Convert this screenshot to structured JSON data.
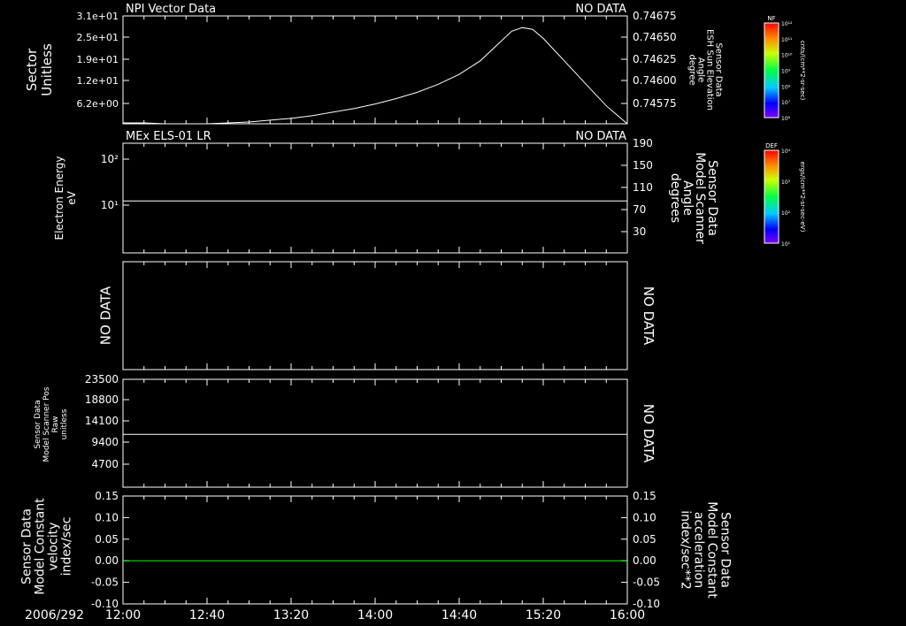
{
  "colors": {
    "background": "#000000",
    "foreground": "#ffffff",
    "model_line": "#00ff00",
    "right_label_panel5": "#00ff00"
  },
  "time_axis": {
    "date_label": "2006/292",
    "start": "12:00",
    "end": "16:00",
    "tick_labels": [
      "12:00",
      "12:40",
      "13:20",
      "14:00",
      "14:40",
      "15:20",
      "16:00"
    ]
  },
  "panels": [
    {
      "id": "panel1",
      "title_left": "NPI Vector Data",
      "title_right": "NO DATA",
      "left_label_lines": [
        "Sector",
        "Unitless"
      ],
      "left_ticks": [
        "3.1e+01",
        "2.5e+01",
        "1.9e+01",
        "1.2e+01",
        "6.2e+00"
      ],
      "right_label_lines": [
        "Sensor Data",
        "ESH Sun Elevation",
        "Angle",
        "degree"
      ],
      "right_ticks": [
        "0.74675",
        "0.74650",
        "0.74625",
        "0.74600",
        "0.74575"
      ]
    },
    {
      "id": "panel2",
      "title_left": "MEx ELS-01 LR",
      "title_right": "NO DATA",
      "left_label_lines": [
        "Electron Energy",
        "eV"
      ],
      "left_ticks": [
        "10²",
        "10¹"
      ],
      "right_label_lines": [
        "Sensor Data",
        "Model Scanner",
        "Angle",
        "degrees"
      ],
      "right_ticks": [
        "190",
        "150",
        "110",
        "70",
        "30"
      ]
    },
    {
      "id": "panel3",
      "left_label_lines": [
        "NO DATA"
      ],
      "right_label_lines": [
        "NO DATA"
      ]
    },
    {
      "id": "panel4",
      "left_label_lines": [
        "Sensor Data",
        "Model Scanner Pos",
        "Raw",
        "unitless"
      ],
      "left_ticks": [
        "23500",
        "18800",
        "14100",
        "9400",
        "4700"
      ],
      "right_label_lines": [
        "NO DATA"
      ]
    },
    {
      "id": "panel5",
      "left_label_lines": [
        "Sensor Data",
        "Model Constant",
        "velocity",
        "index/sec"
      ],
      "left_ticks": [
        "0.15",
        "0.10",
        "0.05",
        "0.00",
        "-0.05",
        "-0.10"
      ],
      "right_label_lines": [
        "Sensor Data",
        "Model Constant",
        "acceleration",
        "index/sec**2"
      ],
      "right_ticks": [
        "0.15",
        "0.10",
        "0.05",
        "0.00",
        "-0.05",
        "-0.10"
      ]
    }
  ],
  "colorbars": [
    {
      "id": "colorbar-nf",
      "title": "NF",
      "tick_labels": [
        "10¹²",
        "10¹¹",
        "10¹⁰",
        "10⁹",
        "10⁸",
        "10⁷",
        "10⁶"
      ],
      "unit": "cnts/(cm**2-sr-sec)"
    },
    {
      "id": "colorbar-def",
      "title": "DEF",
      "tick_labels": [
        "10⁴",
        "10³",
        "10²",
        "10¹"
      ],
      "unit": "ergs/(cm**2-sr-sec-eV)"
    }
  ],
  "chart_data": [
    {
      "type": "line",
      "panel": "panel1",
      "ylim": [
        0.7456,
        0.7468
      ],
      "series": [
        {
          "x": [
            "12:00",
            "12:10",
            "12:20",
            "12:30",
            "12:40",
            "12:50",
            "13:00",
            "13:10",
            "13:20",
            "13:30",
            "13:40",
            "13:50",
            "14:00",
            "14:10",
            "14:20",
            "14:30",
            "14:40",
            "14:50",
            "15:00",
            "15:05",
            "15:10",
            "15:15",
            "15:20",
            "15:30",
            "15:40",
            "15:50",
            "16:00"
          ],
          "y": [
            0.74561,
            0.74561,
            0.7456,
            0.7456,
            0.7456,
            0.74561,
            0.74562,
            0.74564,
            0.74566,
            0.74569,
            0.74573,
            0.74577,
            0.74582,
            0.74588,
            0.74595,
            0.74604,
            0.74615,
            0.7463,
            0.74652,
            0.74663,
            0.74667,
            0.74665,
            0.74655,
            0.7463,
            0.74605,
            0.7458,
            0.74555
          ]
        }
      ]
    },
    {
      "type": "line",
      "panel": "panel2",
      "ylim": [
        0,
        190
      ],
      "series": [
        {
          "x": [
            "12:00",
            "16:00"
          ],
          "y": [
            90,
            90
          ]
        }
      ]
    },
    {
      "type": "line",
      "panel": "panel4",
      "ylim": [
        0,
        23500
      ],
      "series": [
        {
          "x": [
            "12:00",
            "16:00"
          ],
          "y": [
            11500,
            11500
          ]
        }
      ]
    },
    {
      "type": "line",
      "panel": "panel5",
      "ylim": [
        -0.1,
        0.15
      ],
      "series": [
        {
          "x": [
            "12:00",
            "16:00"
          ],
          "y": [
            0.0,
            0.0
          ]
        }
      ]
    }
  ]
}
